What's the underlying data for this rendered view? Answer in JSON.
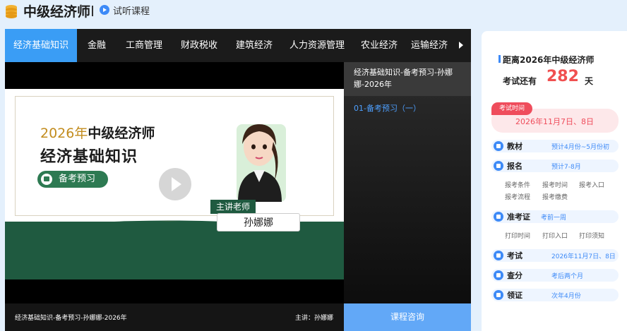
{
  "header": {
    "title": "中级经济师",
    "trial_label": "试听课程",
    "logo_icon": "coins-stack-icon",
    "trial_icon": "play-circle-icon"
  },
  "tabs": [
    {
      "label": "经济基础知识",
      "active": true
    },
    {
      "label": "金融",
      "active": false
    },
    {
      "label": "工商管理",
      "active": false
    },
    {
      "label": "财政税收",
      "active": false
    },
    {
      "label": "建筑经济",
      "active": false
    },
    {
      "label": "人力资源管理",
      "active": false
    },
    {
      "label": "农业经济",
      "active": false
    },
    {
      "label": "运输经济",
      "active": false
    }
  ],
  "video": {
    "slide_year": "2026年",
    "slide_exam": "中级经济师",
    "slide_subject": "经济基础知识",
    "slide_tag": "备考预习",
    "teacher_role": "主讲老师",
    "teacher_name": "孙娜娜",
    "caption": "经济基础知识-备考预习-孙娜娜-2026年",
    "host": "主讲：孙娜娜"
  },
  "playlist": {
    "title": "经济基础知识-备考预习-孙娜娜-2026年",
    "items": [
      "01-备考预习（一）"
    ],
    "consult_button": "课程咨询"
  },
  "panel": {
    "countdown_title": "距离2026年中级经济师",
    "countdown_prefix": "考试还有",
    "countdown_days": "282",
    "countdown_unit": "天",
    "exam_badge": "考试时间",
    "exam_date": "2026年11月7日、8日",
    "rows": [
      {
        "label": "教材",
        "value": "预计4月份~5月份初",
        "icon": "book-icon"
      },
      {
        "label": "报名",
        "value": "预计7-8月",
        "icon": "signup-icon",
        "links": [
          "报考条件",
          "报考时间",
          "报考入口",
          "报考流程",
          "报考缴费"
        ]
      },
      {
        "label": "准考证",
        "value": "考前一周",
        "icon": "ticket-icon",
        "links": [
          "打印时间",
          "打印入口",
          "打印须知"
        ]
      },
      {
        "label": "考试",
        "value": "2026年11月7日、8日",
        "icon": "exam-icon"
      },
      {
        "label": "查分",
        "value": "考后两个月",
        "icon": "score-icon"
      },
      {
        "label": "领证",
        "value": "次年4月份",
        "icon": "certificate-icon"
      }
    ]
  },
  "colors": {
    "accent": "#3a9df5",
    "alert": "#ef4d5c",
    "slide_green": "#1f5a40",
    "slide_gold": "#c28c1e"
  }
}
